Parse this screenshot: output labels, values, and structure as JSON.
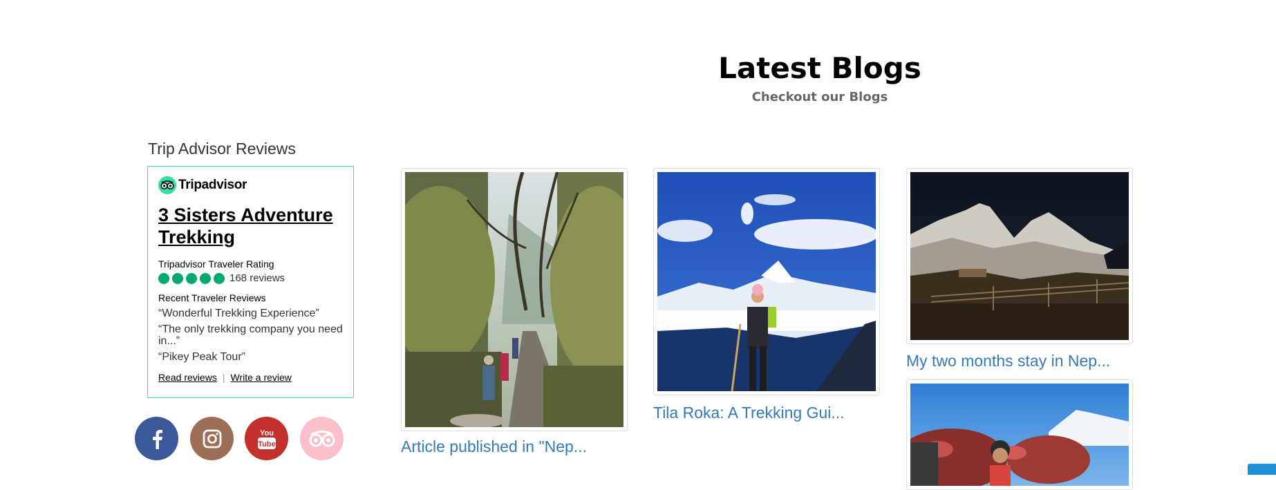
{
  "section": {
    "title": "Latest Blogs",
    "subtitle": "Checkout our Blogs"
  },
  "tripadvisor": {
    "heading": "Trip Advisor Reviews",
    "logo_text": "Tripadvisor",
    "business_name": "3 Sisters Adventure Trekking",
    "rating_label": "Tripadvisor Traveler Rating",
    "rating_bubbles": 5,
    "review_count": "168 reviews",
    "recent_label": "Recent Traveler Reviews",
    "reviews": [
      "“Wonderful Trekking Experience”",
      "“The only trekking company you need in...”",
      "“Pikey Peak Tour”"
    ],
    "read_reviews": "Read reviews",
    "separator": "|",
    "write_review": "Write a review",
    "accent_color": "#34e0a1",
    "bubble_color": "#00aa6c"
  },
  "social": [
    {
      "name": "facebook",
      "icon": "facebook-icon",
      "color": "#3b5998"
    },
    {
      "name": "instagram",
      "icon": "instagram-icon",
      "color": "#9c6e56"
    },
    {
      "name": "youtube",
      "icon": "youtube-icon",
      "color": "#c4302b"
    },
    {
      "name": "tripadvisor",
      "icon": "tripadvisor-icon",
      "color": "#f9c0cb"
    }
  ],
  "blogs": [
    {
      "title": "Article published in \"Nep..."
    },
    {
      "title": "Tila Roka: A Trekking Gui..."
    },
    {
      "title": "My two months stay in Nep..."
    },
    {
      "title": ""
    }
  ],
  "link_color": "#337ab7"
}
